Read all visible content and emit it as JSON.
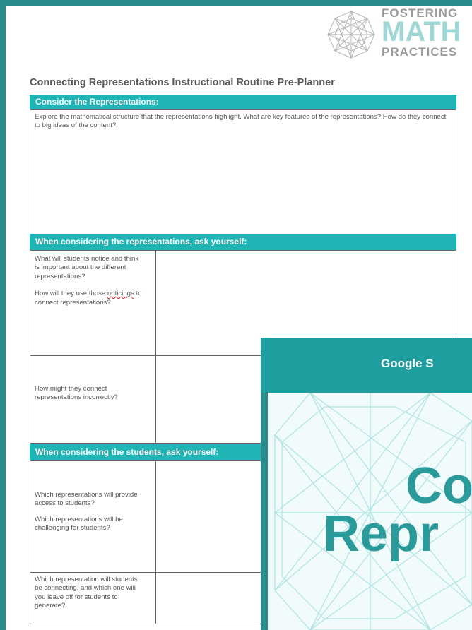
{
  "logo": {
    "line1": "FOSTERING",
    "line2": "MATH",
    "line3": "PRACTICES",
    "mark_icon": "geodesic-sphere-icon"
  },
  "document": {
    "title": "Connecting Representations Instructional Routine Pre-Planner",
    "section1": {
      "header": "Consider the Representations:",
      "prompt": "Explore the mathematical structure that the representations highlight.  What are key features of the representations?  How do they connect to big ideas of the content?"
    },
    "section2": {
      "header": "When considering the representations, ask yourself:",
      "row1": {
        "q1": "What will students notice and think is important about the different representations?",
        "q2_before": "How will they use those ",
        "q2_misspelled": "noticings",
        "q2_after": " to connect representations?"
      },
      "row2": {
        "q": "How might they connect representations incorrectly?"
      }
    },
    "section3": {
      "header": "When considering the students, ask yourself:",
      "row1": {
        "q1": "Which representations will provide access to students?",
        "q2": "Which representations will be challenging for students?"
      },
      "row2": {
        "q": "Which representation will students be connecting, and which one will you leave off for students to generate?"
      }
    }
  },
  "overlay": {
    "header": "Google S",
    "big_line1": "Co",
    "big_line2": "Repr"
  },
  "colors": {
    "teal_header": "#1fb5b5",
    "frame_teal": "#2a8c8c",
    "card_header": "#1e9e9e",
    "big_text": "#2a9a9a"
  }
}
